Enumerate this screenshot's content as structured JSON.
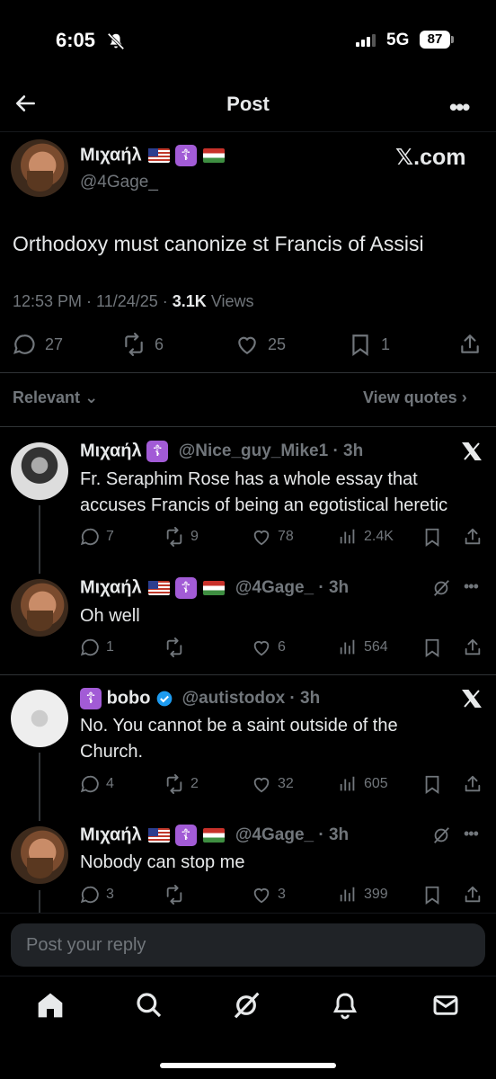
{
  "status_bar": {
    "time": "6:05",
    "network": "5G",
    "battery": "87"
  },
  "nav": {
    "title": "Post"
  },
  "main_post": {
    "author_name": "Μιχαήλ",
    "author_handle": "@4Gage_",
    "badge_glyph": "☦",
    "source_label": "𝕏.com",
    "text": "Orthodoxy must canonize st Francis of Assisi",
    "time": "12:53 PM · 11/24/25 · ",
    "views_count": "3.1K",
    "views_label": " Views",
    "replies": "27",
    "reposts": "6",
    "likes": "25",
    "bookmarks": "1"
  },
  "filter": {
    "relevant_label": "Relevant",
    "view_quotes_label": "View quotes"
  },
  "replies": [
    {
      "name": "Μιχαήλ",
      "handle": "@Nice_guy_Mike1 · 3h",
      "text_line1": "Fr. Seraphim Rose has a whole essay that",
      "text_line2": "accuses Francis of being an egotistical heretic",
      "replies": "7",
      "reposts": "9",
      "likes": "78",
      "views": "2.4K"
    },
    {
      "name": "Μιχαήλ",
      "handle": "@4Gage_ · 3h",
      "text_line1": "Oh well",
      "replies": "1",
      "reposts": "",
      "likes": "6",
      "views": "564"
    },
    {
      "name": "bobo",
      "handle": "@autistodox · 3h",
      "text_line1": "No. You cannot be a saint outside of the",
      "text_line2": "Church.",
      "replies": "4",
      "reposts": "2",
      "likes": "32",
      "views": "605"
    },
    {
      "name": "Μιχαήλ",
      "handle": "@4Gage_ · 3h",
      "text_line1": "Nobody can stop me",
      "replies": "3",
      "reposts": "",
      "likes": "3",
      "views": "399"
    }
  ],
  "composer": {
    "placeholder": "Post your reply"
  },
  "colors": {
    "background": "#000000",
    "text": "#e7e9ea",
    "muted": "#71767b",
    "verified": "#1d9bf0",
    "badge": "#a25bd6"
  }
}
